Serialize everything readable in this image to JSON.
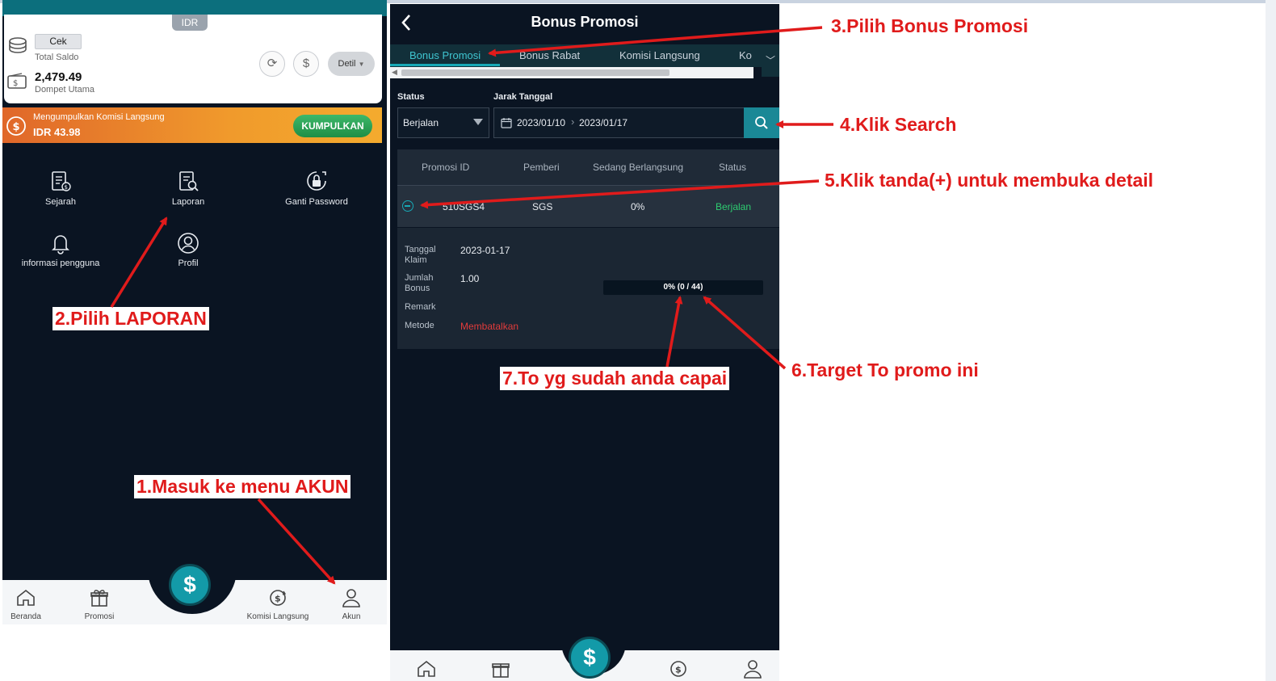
{
  "left_screen": {
    "wallet": {
      "currency_tab": "IDR",
      "cek_label": "Cek",
      "total_saldo_label": "Total Saldo",
      "balance_value": "2,479.49",
      "dompet_label": "Dompet Utama",
      "detil_label": "Detil"
    },
    "commission_banner": {
      "title": "Mengumpulkan Komisi Langsung",
      "amount": "IDR 43.98",
      "button_label": "KUMPULKAN"
    },
    "menu": [
      {
        "label": "Sejarah",
        "icon": "history-document-icon"
      },
      {
        "label": "Laporan",
        "icon": "report-search-icon"
      },
      {
        "label": "Ganti Password",
        "icon": "lock-refresh-icon"
      },
      {
        "label": "informasi pengguna",
        "icon": "bell-icon"
      },
      {
        "label": "Profil",
        "icon": "user-circle-icon"
      }
    ],
    "bottom_nav": [
      {
        "label": "Beranda",
        "icon": "home-icon"
      },
      {
        "label": "Promosi",
        "icon": "gift-icon"
      },
      {
        "label": "Komisi Langsung",
        "icon": "commission-icon"
      },
      {
        "label": "Akun",
        "icon": "user-icon"
      }
    ],
    "fab_symbol": "$"
  },
  "right_screen": {
    "title": "Bonus Promosi",
    "tabs": [
      {
        "label": "Bonus Promosi",
        "active": true
      },
      {
        "label": "Bonus Rabat",
        "active": false
      },
      {
        "label": "Komisi Langsung",
        "active": false
      },
      {
        "label": "Ko",
        "active": false
      }
    ],
    "filters": {
      "status_label": "Status",
      "status_value": "Berjalan",
      "date_label": "Jarak Tanggal",
      "date_from": "2023/01/10",
      "date_to": "2023/01/17"
    },
    "table": {
      "headers": [
        "Promosi ID",
        "Pemberi",
        "Sedang Berlangsung",
        "Status"
      ],
      "row": {
        "promo_id": "510SGS4",
        "giver": "SGS",
        "progress": "0%",
        "status": "Berjalan"
      }
    },
    "detail": {
      "claim_date_label": "Tanggal Klaim",
      "claim_date_value": "2023-01-17",
      "bonus_label": "Jumlah Bonus",
      "bonus_value": "1.00",
      "remark_label": "Remark",
      "method_label": "Metode",
      "method_value": "Membatalkan",
      "turnover_text": "0% (0 / 44)"
    },
    "fab_symbol": "$"
  },
  "annotations": {
    "a1": "1.Masuk ke menu AKUN",
    "a2": "2.Pilih LAPORAN",
    "a3": "3.Pilih Bonus Promosi",
    "a4": "4.Klik Search",
    "a5": "5.Klik tanda(+) untuk membuka detail",
    "a6": "6.Target To promo ini",
    "a7": "7.To yg sudah anda capai"
  },
  "colors": {
    "dark_bg": "#0a1422",
    "accent_teal": "#18a9b6",
    "active_green": "#2ecc71",
    "cancel_red": "#e23b3b",
    "annotation_red": "#e01b1b"
  }
}
